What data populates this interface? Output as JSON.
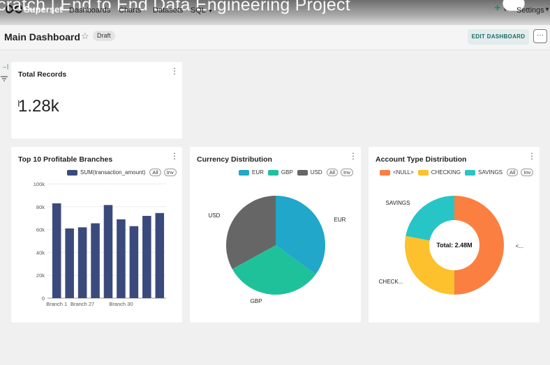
{
  "video_overlay_title": "cratch | End to End Data Engineering Project",
  "topnav": {
    "brand": "Superset",
    "items": [
      "Dashboards",
      "Charts",
      "Datasets",
      "SQL"
    ],
    "settings_label": "Settings"
  },
  "header": {
    "title": "Main Dashboard",
    "badge": "Draft",
    "edit_button": "EDIT DASHBOARD",
    "more_button": "···"
  },
  "total_records": {
    "title": "Total Records",
    "value": "1.28k"
  },
  "branches": {
    "title": "Top 10 Profitable Branches",
    "legend": "SUM(transaction_amount)",
    "pill_all": "All",
    "pill_inv": "Inv"
  },
  "currency": {
    "title": "Currency Distribution",
    "legend": [
      "EUR",
      "GBP",
      "USD"
    ],
    "pill_all": "All",
    "pill_inv": "Inv"
  },
  "account_type": {
    "title": "Account Type Distribution",
    "legend": [
      "<NULL>",
      "CHECKING",
      "SAVINGS"
    ],
    "pill_all": "All",
    "pill_inv": "Inv",
    "center_label": "Total: 2.48M"
  },
  "colors": {
    "bar": "#3b4a7c",
    "EUR": "#20a7c9",
    "GBP": "#1fc19b",
    "USD": "#666666",
    "NULL": "#fb7f40",
    "CHECKING": "#fcc12d",
    "SAVINGS": "#27c5c6",
    "accent": "#1a6b68"
  },
  "chart_data": [
    {
      "type": "bar",
      "title": "Top 10 Profitable Branches",
      "series": [
        {
          "name": "SUM(transaction_amount)",
          "values": [
            83000,
            61000,
            62000,
            65500,
            81500,
            69000,
            63000,
            72000,
            74500
          ]
        }
      ],
      "categories": [
        "Branch 1",
        "",
        "Branch 27",
        "",
        "",
        "Branch 30",
        "",
        "",
        ""
      ],
      "yticks": [
        "0",
        "20k",
        "40k",
        "60k",
        "80k",
        "100k"
      ],
      "ylim": [
        0,
        100000
      ],
      "xlabel": "",
      "ylabel": "",
      "grid": true
    },
    {
      "type": "pie",
      "title": "Currency Distribution",
      "labels": [
        "EUR",
        "GBP",
        "USD"
      ],
      "values": [
        35,
        32,
        33
      ]
    },
    {
      "type": "pie",
      "title": "Account Type Distribution",
      "labels": [
        "<NULL>",
        "CHECKING",
        "SAVINGS"
      ],
      "display_labels": [
        "<...",
        "CHECK...",
        "SAVINGS"
      ],
      "values": [
        50,
        28,
        22
      ],
      "donut": true
    }
  ]
}
